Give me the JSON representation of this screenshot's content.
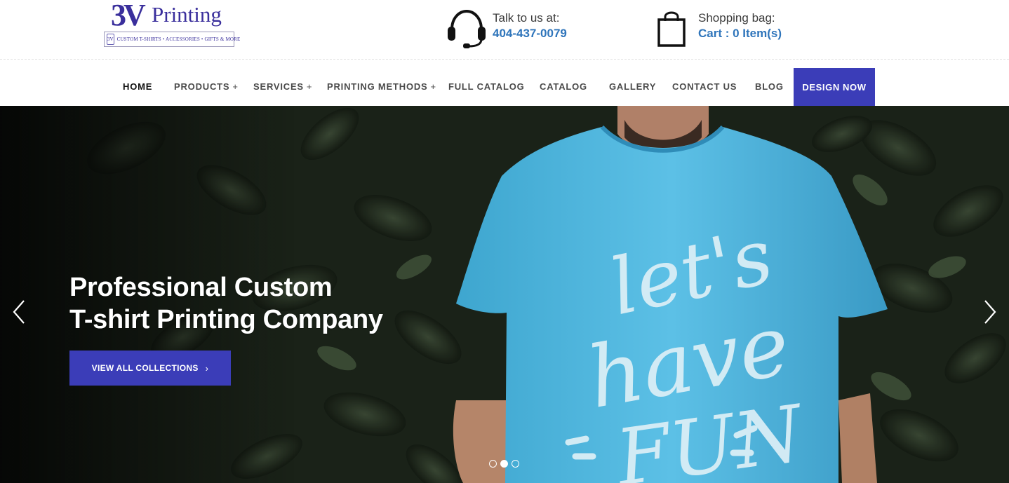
{
  "logo": {
    "mark": "3V",
    "word": "Printing",
    "tagline": "CUSTOM T-SHIRTS • ACCESSORIES • GIFTS & MORE"
  },
  "contact": {
    "label": "Talk to us at:",
    "phone": "404-437-0079",
    "icon": "headset-icon"
  },
  "bag": {
    "label": "Shopping bag:",
    "cart": "Cart : 0 Item(s)",
    "icon": "shopping-bag-icon"
  },
  "nav": {
    "items": [
      {
        "label": "HOME",
        "plus": ""
      },
      {
        "label": "PRODUCTS",
        "plus": "+"
      },
      {
        "label": "SERVICES",
        "plus": "+"
      },
      {
        "label": "PRINTING METHODS",
        "plus": "+"
      },
      {
        "label": "FULL CATALOG",
        "plus": ""
      },
      {
        "label": "CATALOG",
        "plus": ""
      },
      {
        "label": "GALLERY",
        "plus": ""
      },
      {
        "label": "CONTACT US",
        "plus": ""
      },
      {
        "label": "BLOG",
        "plus": ""
      }
    ],
    "cta": "DESIGN NOW"
  },
  "hero": {
    "line1": "Professional Custom",
    "line2": "T-shirt Printing Company",
    "button": "VIEW ALL COLLECTIONS",
    "button_chevron": "›",
    "shirt_print": [
      "let's",
      "have",
      "FUN"
    ],
    "slides_total": 3,
    "active_slide": 2
  },
  "colors": {
    "brand": "#3a2f9c",
    "accent": "#3b3db8",
    "link": "#2f75bb",
    "shirt": "#4fb6dd"
  }
}
